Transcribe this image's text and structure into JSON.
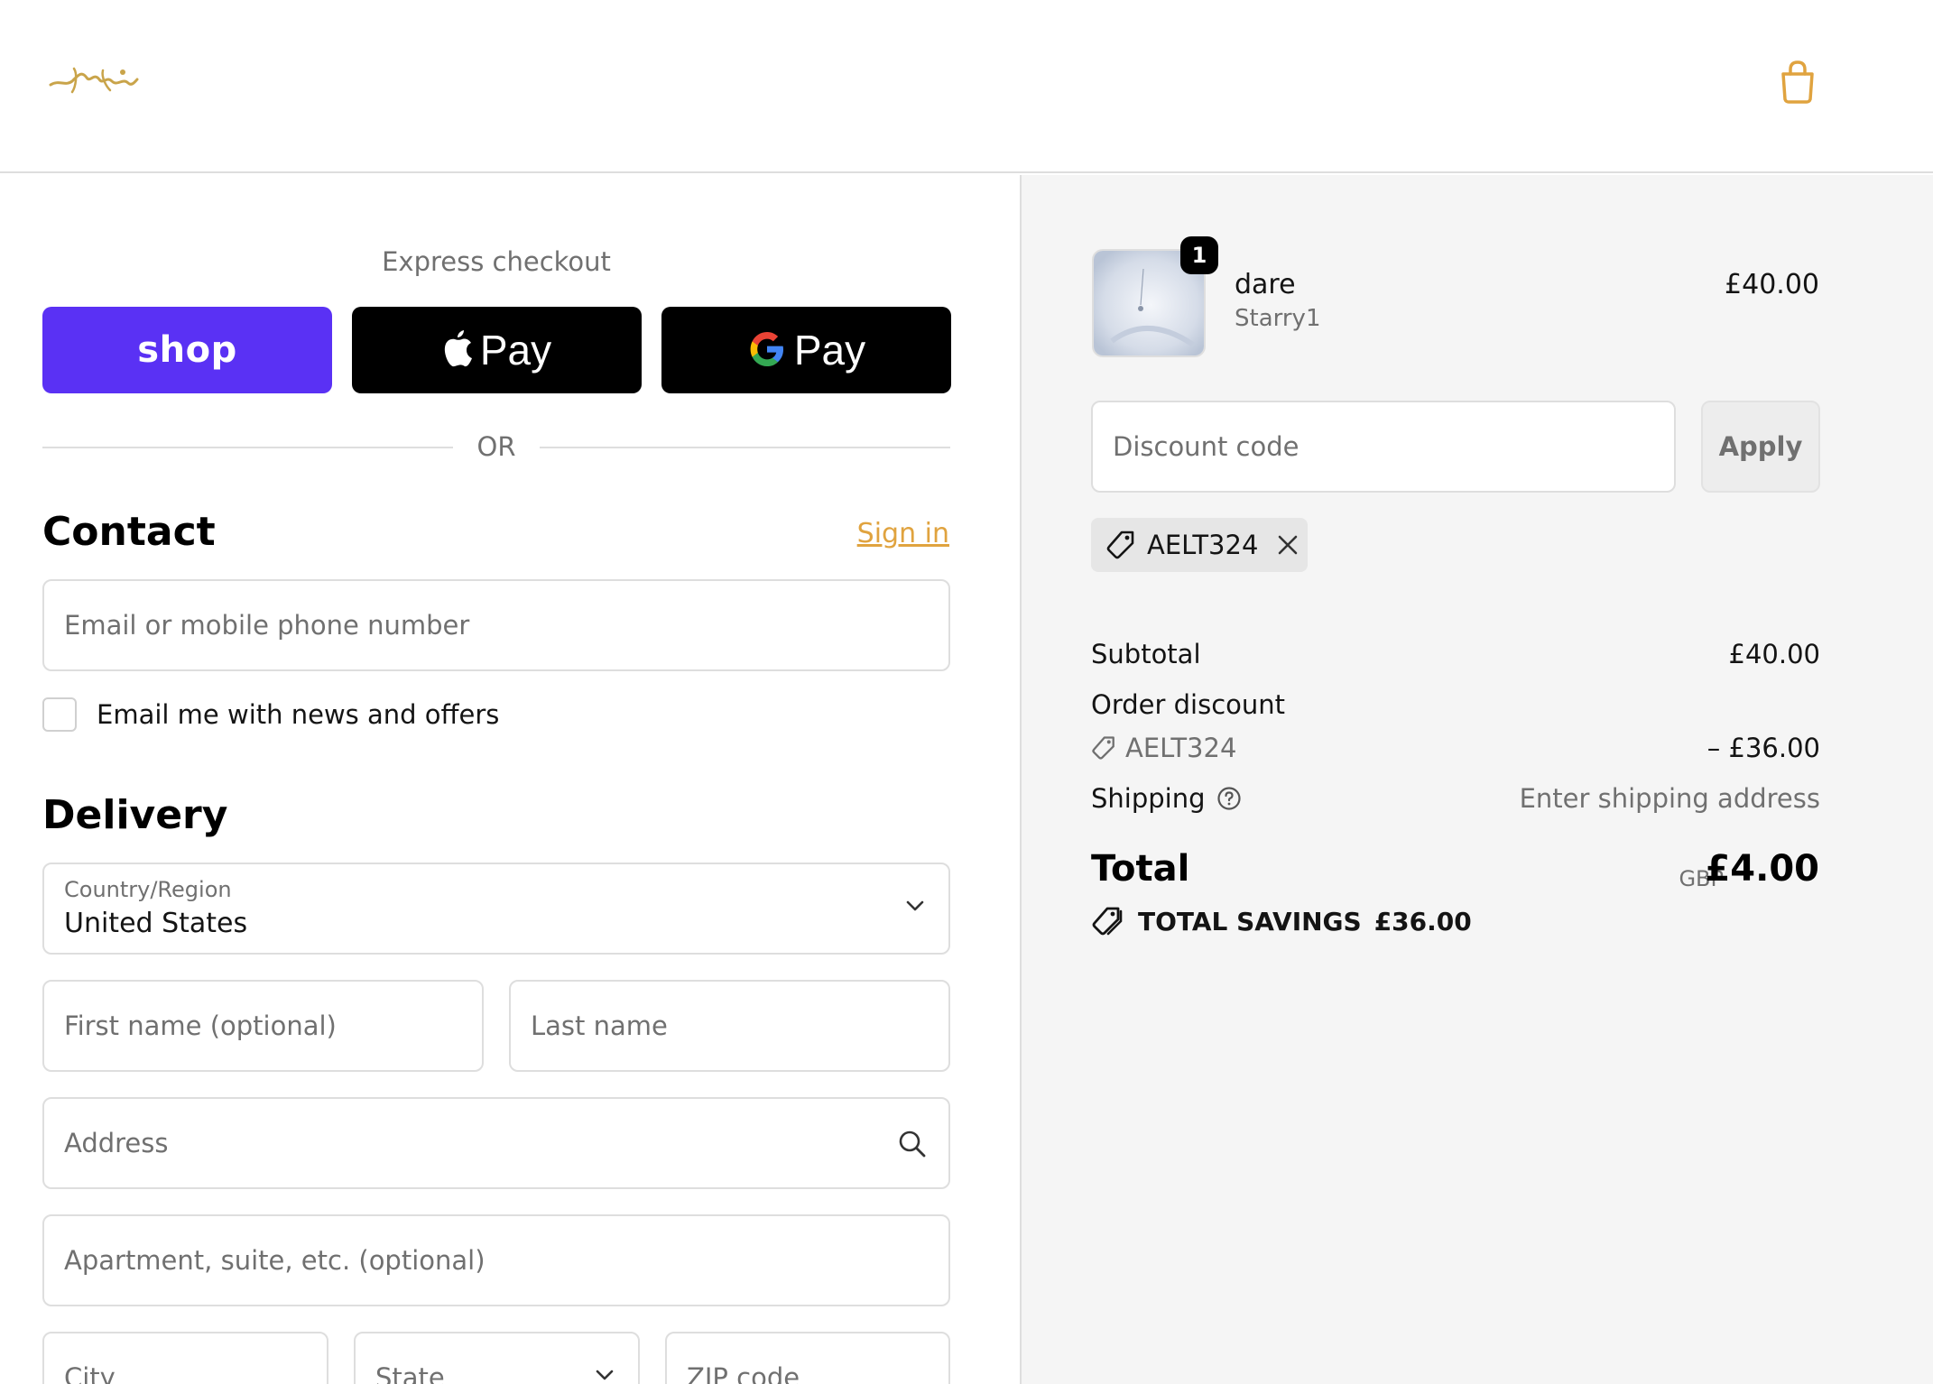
{
  "header": {
    "logo_alt": "Store logo",
    "accent_color": "#e0a33f"
  },
  "express": {
    "title": "Express checkout",
    "shop_label": "shop",
    "apple_label": "Pay",
    "gpay_g": "G",
    "gpay_label": "Pay",
    "or_label": "OR"
  },
  "contact": {
    "title": "Contact",
    "sign_in": "Sign in",
    "email_placeholder": "Email or mobile phone number",
    "newsletter_label": "Email me with news and offers"
  },
  "delivery": {
    "title": "Delivery",
    "country_label": "Country/Region",
    "country_value": "United States",
    "first_name_placeholder": "First name (optional)",
    "last_name_placeholder": "Last name",
    "address_placeholder": "Address",
    "apartment_placeholder": "Apartment, suite, etc. (optional)",
    "city_placeholder": "City",
    "state_placeholder": "State",
    "zip_placeholder": "ZIP code"
  },
  "order": {
    "item": {
      "name": "dare",
      "variant": "Starry1",
      "price": "£40.00",
      "quantity": "1"
    },
    "discount_placeholder": "Discount code",
    "apply_label": "Apply",
    "applied_code": "AELT324",
    "subtotal_label": "Subtotal",
    "subtotal_value": "£40.00",
    "order_discount_label": "Order discount",
    "discount_code": "AELT324",
    "discount_value": "– £36.00",
    "shipping_label": "Shipping",
    "shipping_value": "Enter shipping address",
    "total_label": "Total",
    "total_currency": "GBP",
    "total_value": "£4.00",
    "savings_label": "TOTAL SAVINGS",
    "savings_value": "£36.00"
  },
  "colors": {
    "shop_purple": "#5a31f4",
    "link": "#e0a33f",
    "sidebar_bg": "#f5f5f5"
  }
}
